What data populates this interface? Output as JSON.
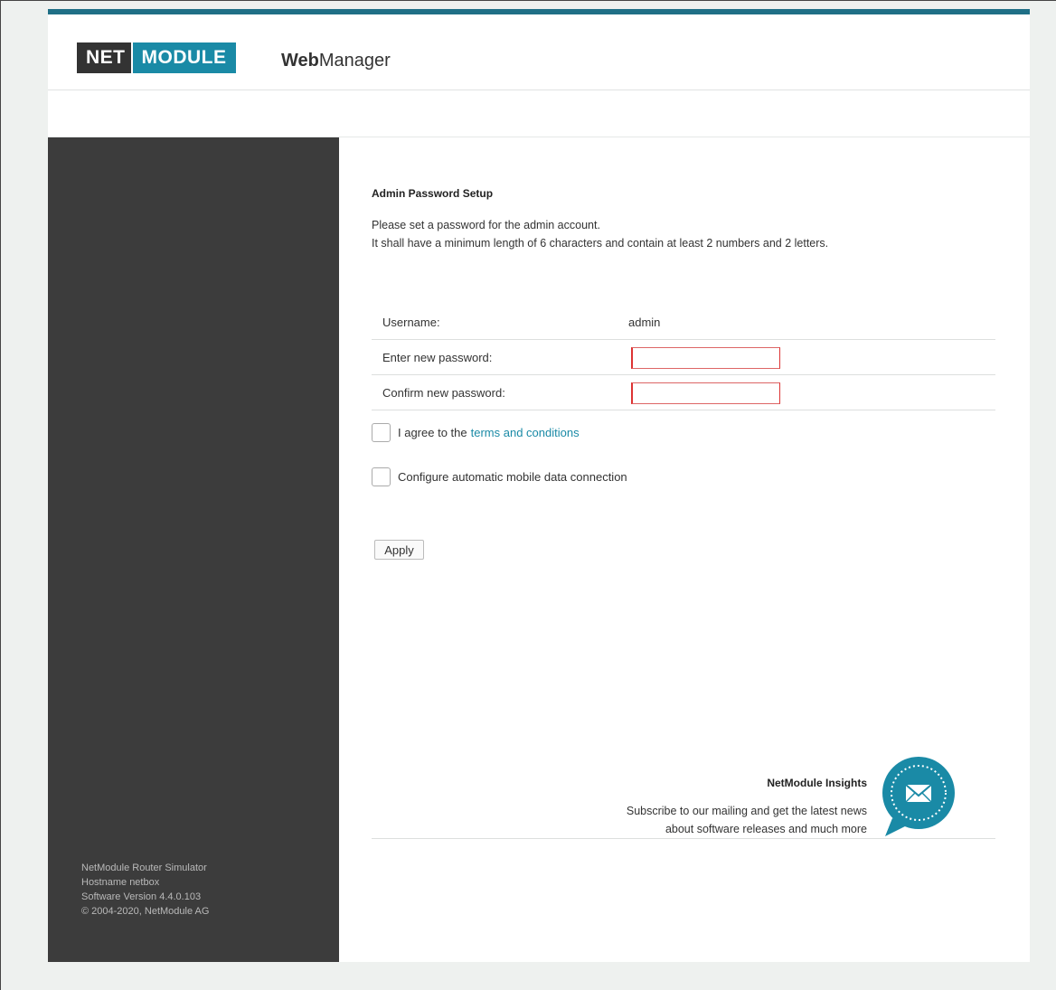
{
  "header": {
    "logo_net": "NET",
    "logo_module": "MODULE",
    "brand_bold": "Web",
    "brand_rest": "Manager"
  },
  "colors": {
    "accent": "#1a8aa6",
    "top_bar": "#1f6f86",
    "sidebar": "#3c3c3c",
    "error_border": "#dd3333"
  },
  "sidebar": {
    "info": [
      "NetModule Router Simulator",
      "Hostname netbox",
      "Software Version 4.4.0.103",
      "© 2004-2020, NetModule AG"
    ]
  },
  "setup": {
    "title": "Admin Password Setup",
    "desc_line1": "Please set a password for the admin account.",
    "desc_line2": "It shall have a minimum length of 6 characters and contain at least 2 numbers and 2 letters.",
    "username_label": "Username:",
    "username_value": "admin",
    "new_pw_label": "Enter new password:",
    "new_pw_value": "",
    "confirm_pw_label": "Confirm new password:",
    "confirm_pw_value": "",
    "agree_text": "I agree to the",
    "terms_link": "terms and conditions",
    "mobile_text": "Configure automatic mobile data connection",
    "apply_label": "Apply"
  },
  "insights": {
    "title": "NetModule Insights",
    "line1": "Subscribe to our mailing and get the latest news",
    "line2": "about software releases and much more",
    "icon": "mail-icon"
  }
}
